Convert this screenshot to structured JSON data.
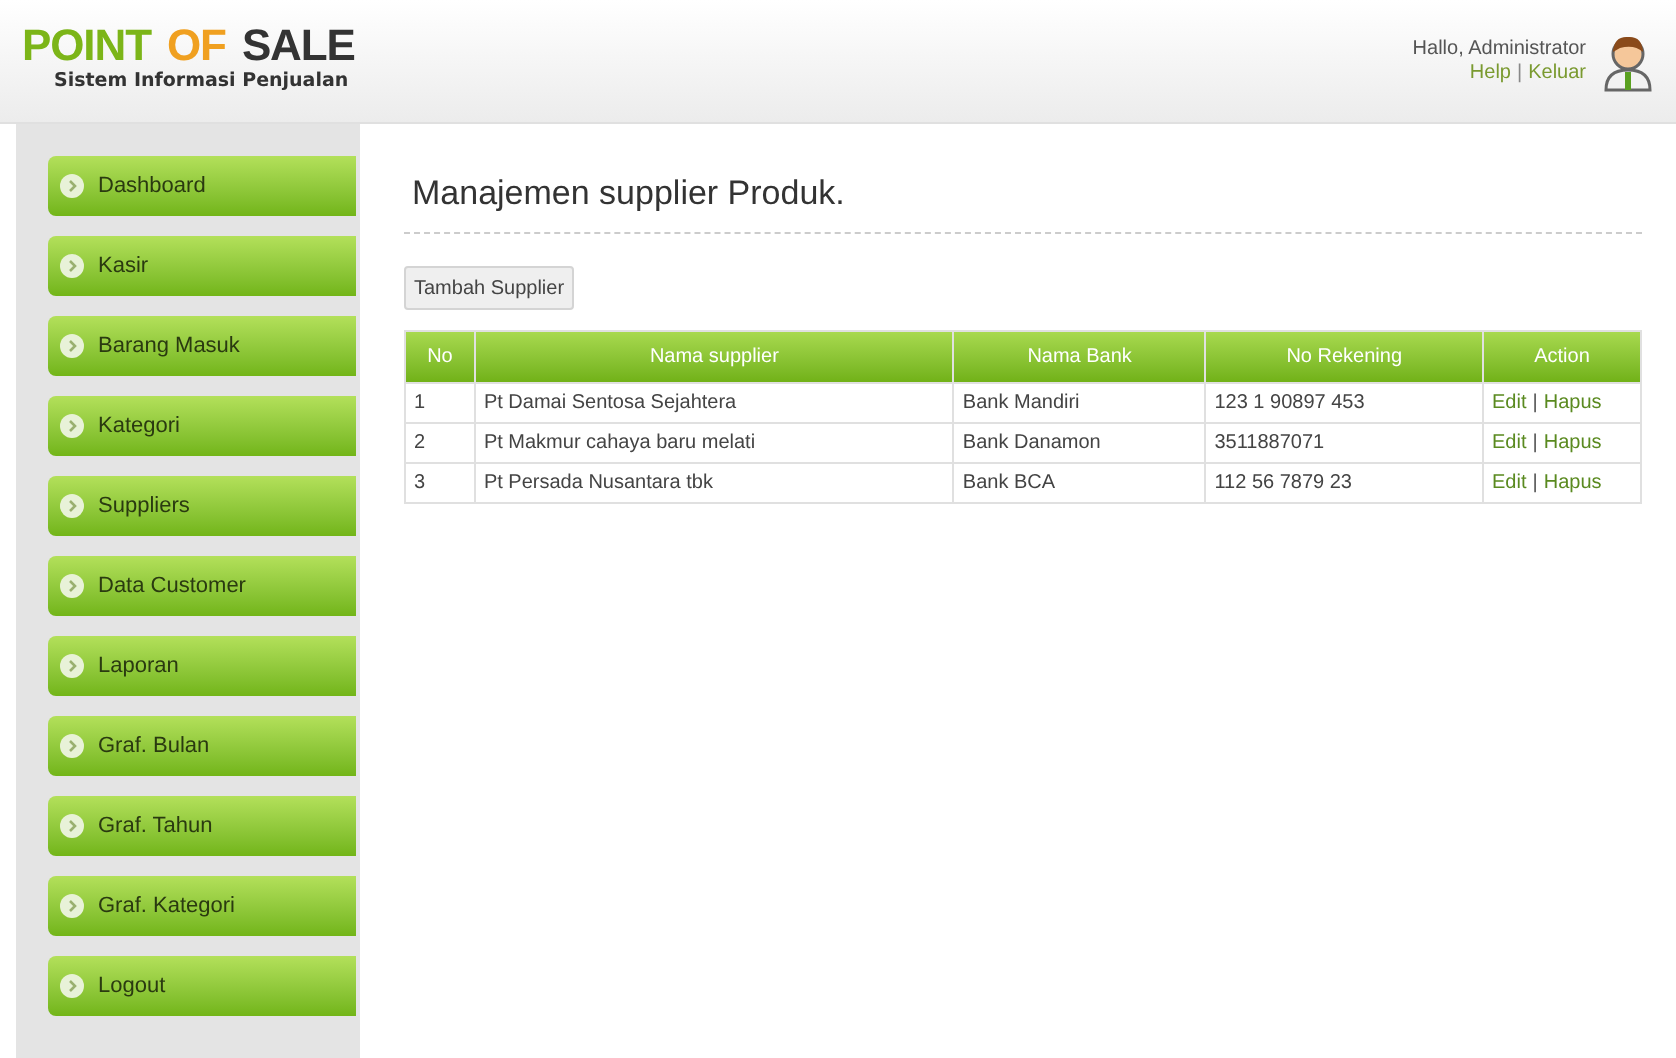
{
  "header": {
    "logo": [
      {
        "text": "POINT",
        "color": "#7cb518"
      },
      {
        "text": "OF",
        "color": "#f0a020"
      },
      {
        "text": "SALE",
        "color": "#333333"
      }
    ],
    "subtitle": "Sistem Informasi Penjualan",
    "greeting": "Hallo, Administrator",
    "links": [
      "Help",
      "Keluar"
    ],
    "separator": "|"
  },
  "sidebar": {
    "items": [
      {
        "label": "Dashboard"
      },
      {
        "label": "Kasir"
      },
      {
        "label": "Barang Masuk"
      },
      {
        "label": "Kategori"
      },
      {
        "label": "Suppliers"
      },
      {
        "label": "Data Customer"
      },
      {
        "label": "Laporan"
      },
      {
        "label": "Graf. Bulan"
      },
      {
        "label": "Graf. Tahun"
      },
      {
        "label": "Graf. Kategori"
      },
      {
        "label": "Logout"
      }
    ]
  },
  "page": {
    "title": "Manajemen supplier Produk.",
    "add_button": "Tambah Supplier"
  },
  "table": {
    "columns": [
      "No",
      "Nama supplier",
      "Nama Bank",
      "No Rekening",
      "Action"
    ],
    "rows": [
      {
        "no": "1",
        "name": "Pt Damai Sentosa Sejahtera",
        "bank": "Bank Mandiri",
        "account": "123 1 90897 453",
        "actions": [
          "Edit",
          "Hapus"
        ]
      },
      {
        "no": "2",
        "name": "Pt Makmur cahaya baru melati",
        "bank": "Bank Danamon",
        "account": "3511887071",
        "actions": [
          "Edit",
          "Hapus"
        ]
      },
      {
        "no": "3",
        "name": "Pt Persada Nusantara tbk",
        "bank": "Bank BCA",
        "account": "112 56 7879 23",
        "actions": [
          "Edit",
          "Hapus"
        ]
      }
    ],
    "separator": "|"
  }
}
